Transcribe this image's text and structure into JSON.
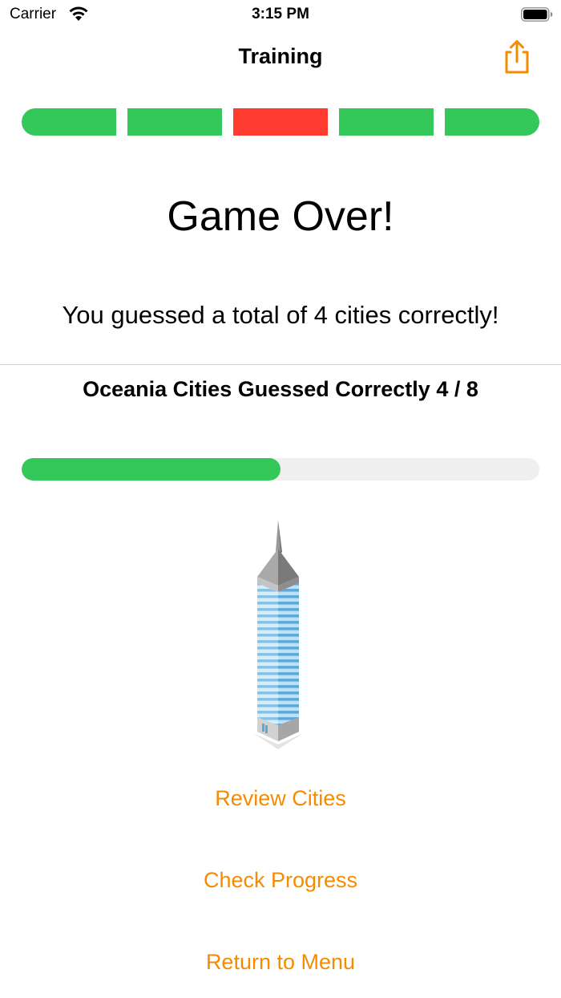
{
  "status_bar": {
    "carrier": "Carrier",
    "time": "3:15 PM",
    "icons": [
      "wifi-icon",
      "battery-icon"
    ]
  },
  "nav": {
    "title": "Training",
    "share_icon": "share-icon"
  },
  "rounds": [
    {
      "result": "correct",
      "color": "#34c759"
    },
    {
      "result": "correct",
      "color": "#34c759"
    },
    {
      "result": "incorrect",
      "color": "#ff3b30"
    },
    {
      "result": "correct",
      "color": "#34c759"
    },
    {
      "result": "correct",
      "color": "#34c759"
    }
  ],
  "result": {
    "heading": "Game Over!",
    "summary": "You guessed a total of 4 cities correctly!"
  },
  "region_progress": {
    "label": "Oceania Cities Guessed Correctly 4 / 8",
    "correct": 4,
    "total": 8,
    "fill_color": "#34c759",
    "track_color": "#efefef"
  },
  "illustration": "skyscraper-illustration",
  "actions": {
    "review": "Review Cities",
    "progress": "Check Progress",
    "menu": "Return to Menu"
  },
  "colors": {
    "accent": "#f58b00",
    "correct": "#34c759",
    "incorrect": "#ff3b30"
  }
}
